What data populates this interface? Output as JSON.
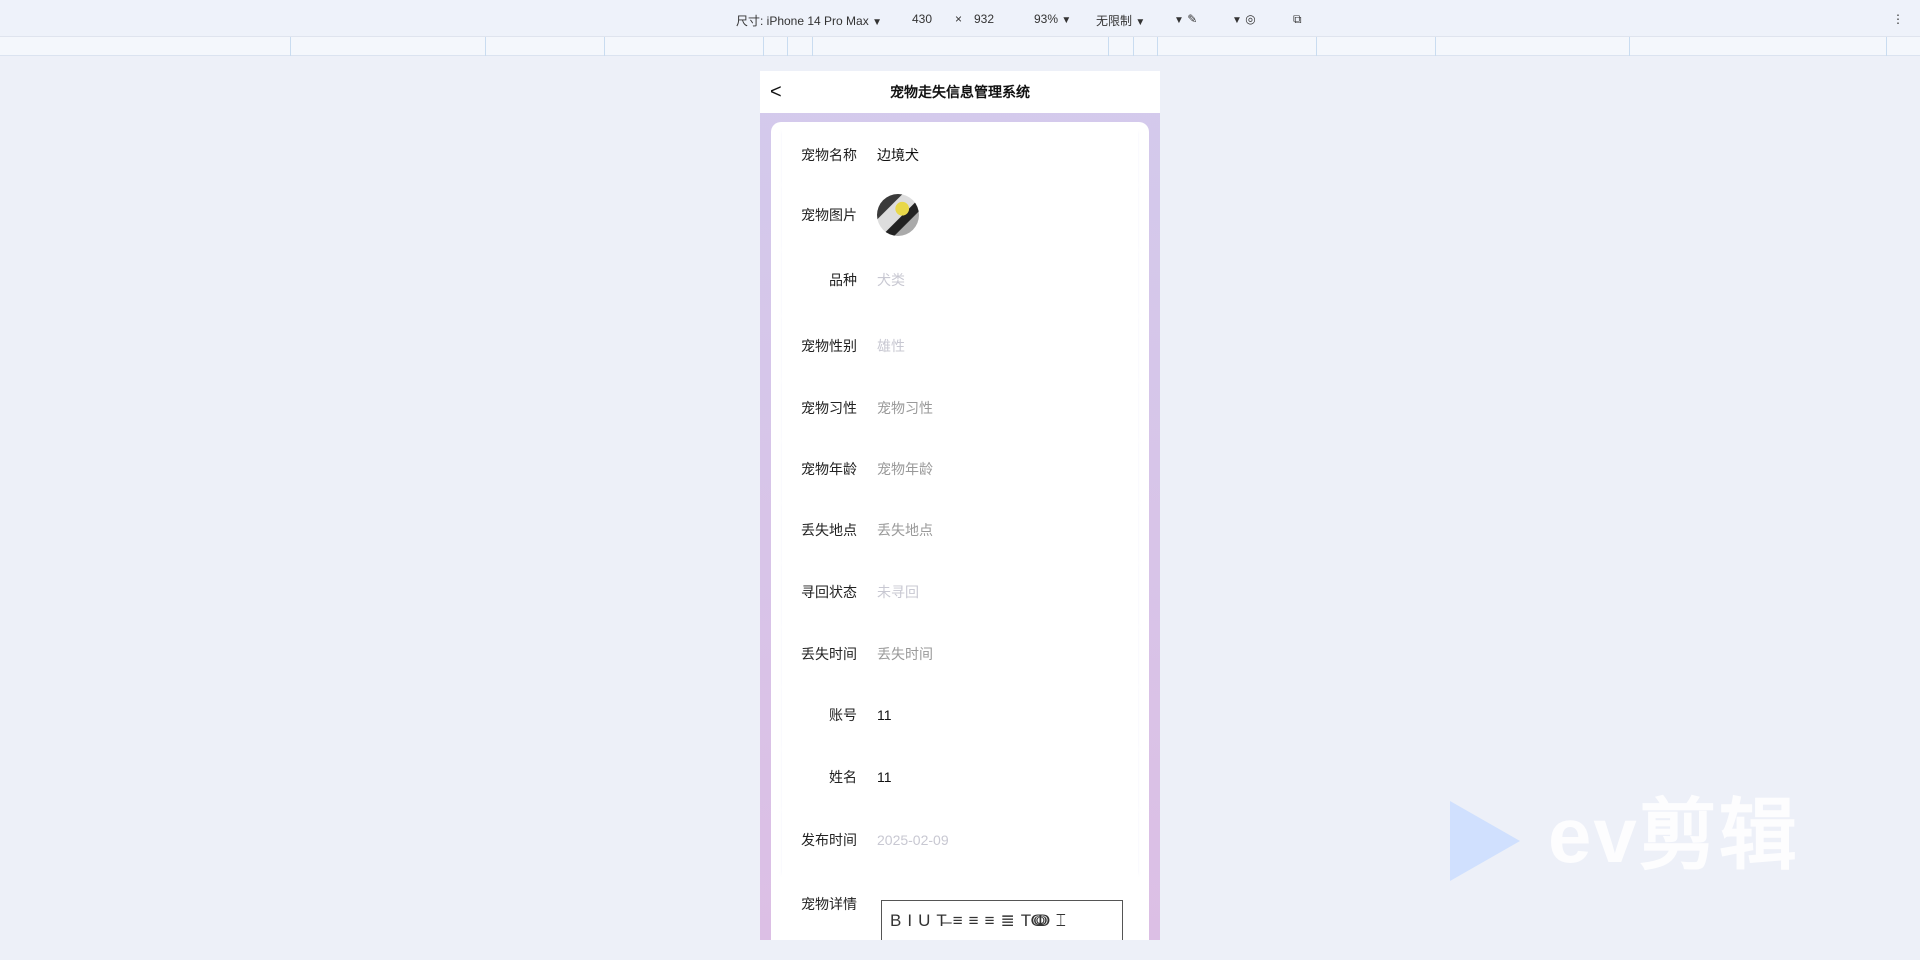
{
  "devtools": {
    "size_label": "尺寸: iPhone 14 Pro Max",
    "width": "430",
    "times": "×",
    "height": "932",
    "zoom": "93%",
    "throttle": "无限制"
  },
  "app": {
    "title": "宠物走失信息管理系统"
  },
  "form": {
    "rows": [
      {
        "label": "宠物名称",
        "value": "边境犬",
        "style": "val"
      },
      {
        "label": "宠物图片",
        "type": "image"
      },
      {
        "label": "品种",
        "value": "犬类",
        "style": "dis"
      },
      {
        "label": "宠物性别",
        "value": "雄性",
        "style": "dis"
      },
      {
        "label": "宠物习性",
        "value": "宠物习性",
        "style": "ph"
      },
      {
        "label": "宠物年龄",
        "value": "宠物年龄",
        "style": "ph"
      },
      {
        "label": "丢失地点",
        "value": "丢失地点",
        "style": "ph"
      },
      {
        "label": "寻回状态",
        "value": "未寻回",
        "style": "dis"
      },
      {
        "label": "丢失时间",
        "value": "丢失时间",
        "style": "ph"
      },
      {
        "label": "账号",
        "value": "11",
        "style": "val"
      },
      {
        "label": "姓名",
        "value": "11",
        "style": "val"
      },
      {
        "label": "发布时间",
        "value": "2025-02-09",
        "style": "dis"
      },
      {
        "label": "宠物详情",
        "type": "editor"
      }
    ],
    "editor_tools": [
      "B",
      "I",
      "U",
      "T̶",
      "≡",
      "≡",
      "≡",
      "≣",
      "Tↈ",
      "⌶"
    ]
  },
  "watermark": "ev剪辑"
}
